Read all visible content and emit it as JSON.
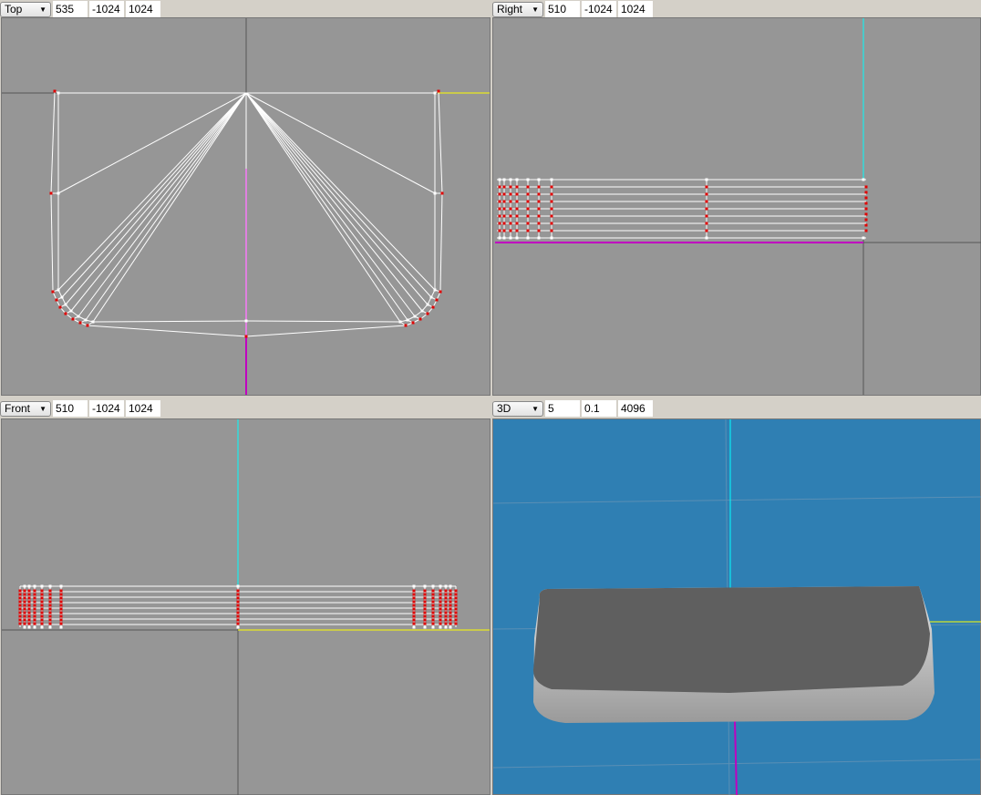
{
  "viewports": [
    {
      "view": "Top",
      "values": [
        "535",
        "-1024",
        "1024"
      ]
    },
    {
      "view": "Right",
      "values": [
        "510",
        "-1024",
        "1024"
      ]
    },
    {
      "view": "Front",
      "values": [
        "510",
        "-1024",
        "1024"
      ]
    },
    {
      "view": "3D",
      "values": [
        "5",
        "0.1",
        "4096"
      ]
    }
  ],
  "colors": {
    "viewport_bg": "#969696",
    "viewport_3d_bg": "#2f7fb3",
    "wire": "#ffffff",
    "vertex_selected": "#e00000",
    "axis_x": "#ffff00",
    "axis_y": "#00ffff",
    "axis_z": "#c000c0"
  },
  "icons": {
    "dropdown": "chevron-down-icon"
  }
}
